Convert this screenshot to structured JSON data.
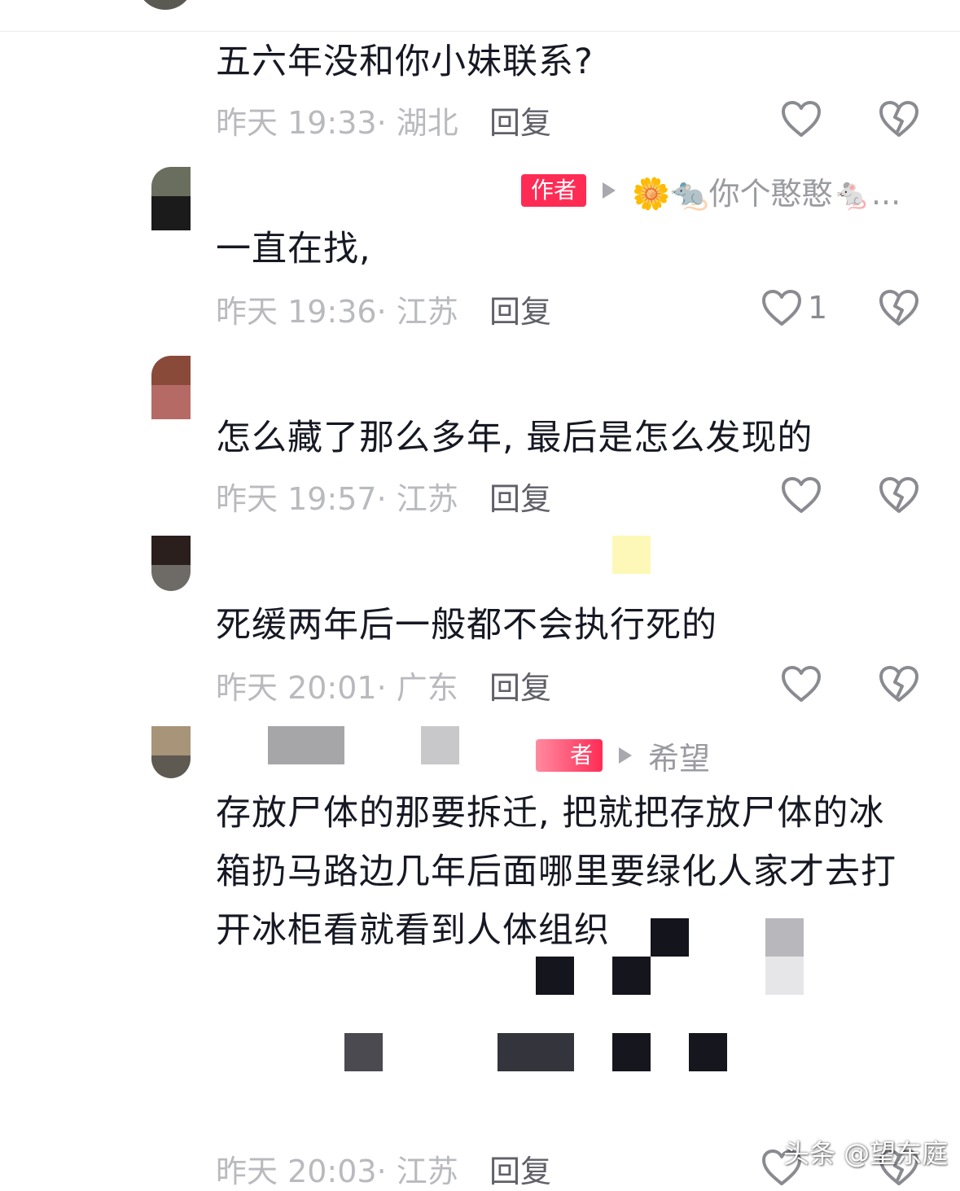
{
  "comments": [
    {
      "text": "五六年没和你小妹联系?",
      "time": "昨天 19:33· 湖北",
      "reply_label": "回复"
    },
    {
      "author_tag": "作者",
      "reply_to": "🌼🐀你个憨憨🐁...",
      "text": "一直在找,",
      "time": "昨天 19:36· 江苏",
      "reply_label": "回复",
      "likes": "1"
    },
    {
      "text": "怎么藏了那么多年, 最后是怎么发现的",
      "time": "昨天 19:57· 江苏",
      "reply_label": "回复"
    },
    {
      "text": "死缓两年后一般都不会执行死的",
      "time": "昨天 20:01· 广东",
      "reply_label": "回复"
    },
    {
      "author_tag": "者",
      "reply_to": "希望",
      "text": "存放尸体的那要拆迁, 把就把存放尸体的冰箱扔马路边几年后面哪里要绿化人家才去打开冰柜看就看到人体组织",
      "time": "昨天 20:03· 江苏",
      "reply_label": "回复"
    }
  ],
  "icons": {
    "like": "heart-outline-icon",
    "dislike": "broken-heart-icon"
  },
  "colors": {
    "author_tag": "#fe2c55",
    "meta": "#b9babe",
    "reply": "#5f6068"
  },
  "watermark": "头条 @望东庭"
}
